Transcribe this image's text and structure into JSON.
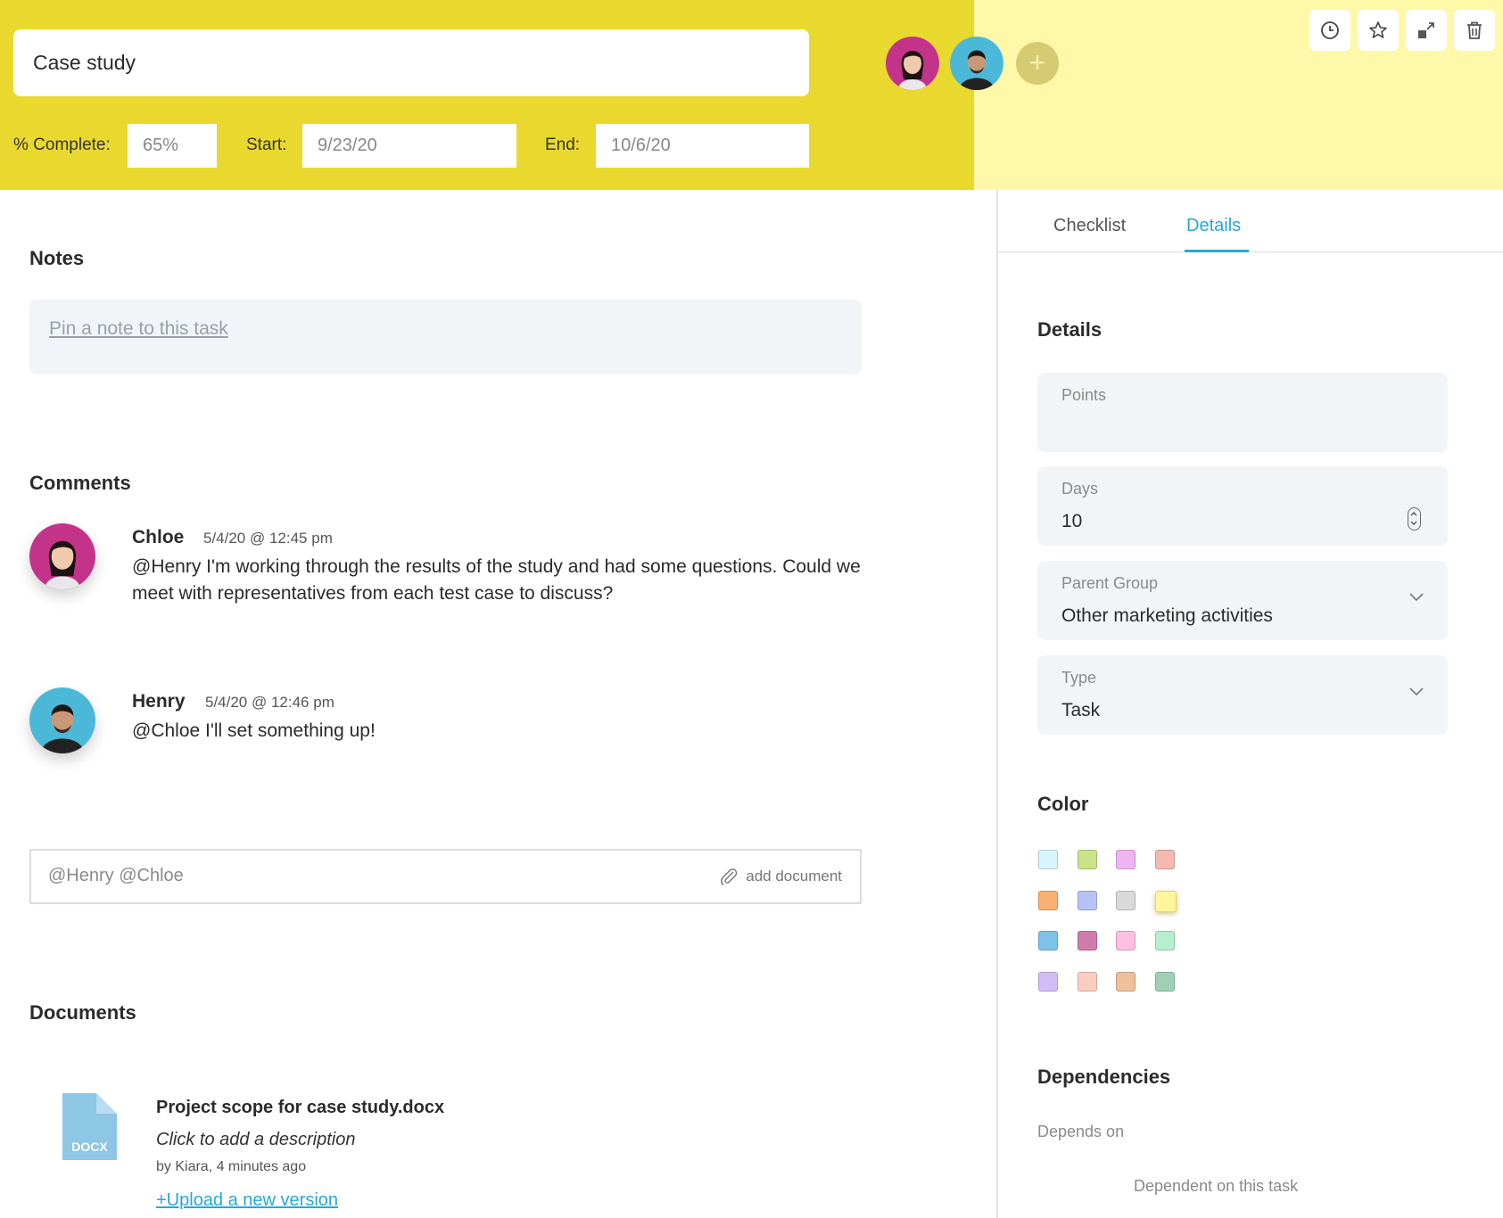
{
  "header": {
    "title": "Case study",
    "complete_label": "% Complete:",
    "complete_value": "65%",
    "start_label": "Start:",
    "start_value": "9/23/20",
    "end_label": "End:",
    "end_value": "10/6/20",
    "add_member_symbol": "+",
    "header_color": "#e9d92e",
    "header_light_color": "#fff8a9"
  },
  "toolbar": {
    "icons": [
      "history-icon",
      "star-icon",
      "expand-icon",
      "trash-icon"
    ]
  },
  "notes": {
    "title": "Notes",
    "placeholder_link": "Pin a note to this task"
  },
  "comments": {
    "title": "Comments",
    "items": [
      {
        "author": "Chloe",
        "time": "5/4/20 @ 12:45 pm",
        "text": "@Henry I'm working through the results of the study and had some questions. Could we meet with representatives from each test case to discuss?"
      },
      {
        "author": "Henry",
        "time": "5/4/20 @ 12:46 pm",
        "text": "@Chloe I'll set something up!"
      }
    ],
    "input_value": "@Henry @Chloe",
    "add_document": "add document"
  },
  "documents": {
    "title": "Documents",
    "items": [
      {
        "name": "Project scope for case study.docx",
        "description": "Click to add a description",
        "meta": "by Kiara, 4 minutes ago",
        "upload_link": "+Upload a new version",
        "file_type": "DOCX"
      }
    ]
  },
  "panel": {
    "tabs": [
      {
        "label": "Checklist",
        "active": false
      },
      {
        "label": "Details",
        "active": true
      }
    ],
    "details_title": "Details",
    "points_label": "Points",
    "points_value": "",
    "days_label": "Days",
    "days_value": "10",
    "parent_group_label": "Parent Group",
    "parent_group_value": "Other marketing activities",
    "type_label": "Type",
    "type_value": "Task",
    "color_title": "Color",
    "colors": [
      "#d6f6fb",
      "#c8e38a",
      "#efb5f0",
      "#f6b9b1",
      "#f9b071",
      "#b5c3f6",
      "#d9d9d9",
      "#fff59b",
      "#7cc2ea",
      "#d17bab",
      "#fbbfe3",
      "#b5efcf",
      "#d3bdf6",
      "#fbcdc1",
      "#efc099",
      "#9fd1b6"
    ],
    "selected_color": "#fff59b",
    "dependencies_title": "Dependencies",
    "depends_on_label": "Depends on",
    "dependent_on_label": "Dependent on this task"
  },
  "accent_color": "#27a7d8"
}
